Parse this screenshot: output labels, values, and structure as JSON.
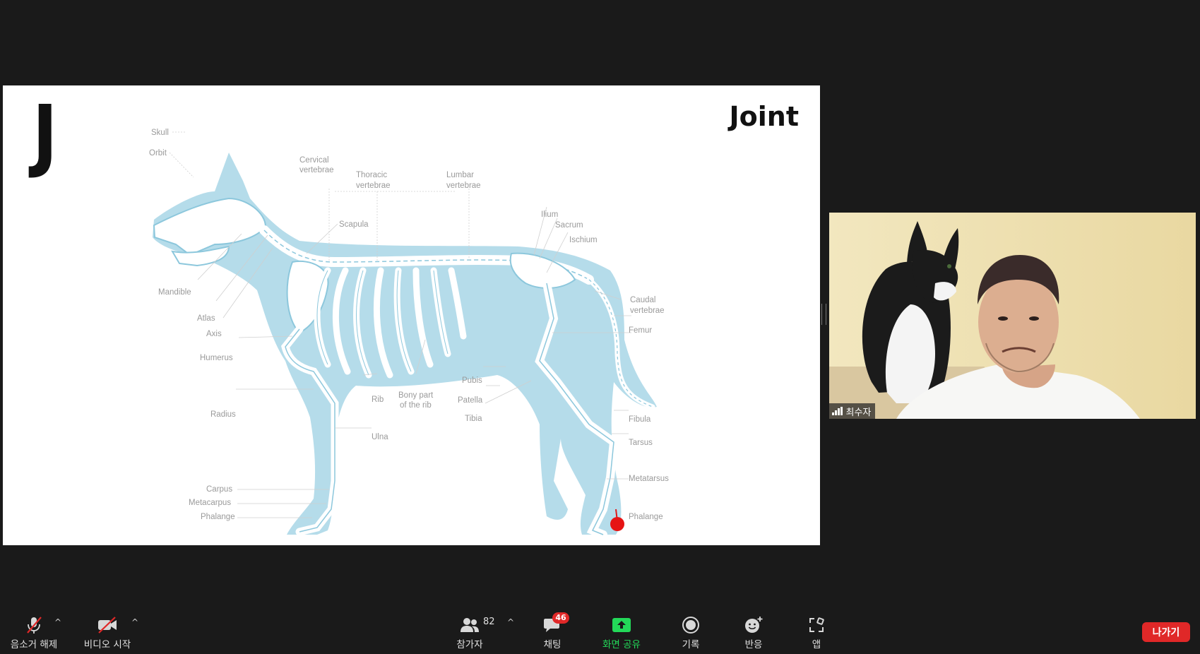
{
  "slide": {
    "letter": "J",
    "title": "Joint",
    "labels": {
      "skull": "Skull",
      "orbit": "Orbit",
      "cervical1": "Cervical",
      "cervical2": "vertebrae",
      "thoracic1": "Thoracic",
      "thoracic2": "vertebrae",
      "lumbar1": "Lumbar",
      "lumbar2": "vertebrae",
      "scapula": "Scapula",
      "ilium": "Ilium",
      "sacrum": "Sacrum",
      "ischium": "Ischium",
      "mandible": "Mandible",
      "atlas": "Atlas",
      "axis": "Axis",
      "humerus": "Humerus",
      "caudal1": "Caudal",
      "caudal2": "vertebrae",
      "femur": "Femur",
      "pubis": "Pubis",
      "bony1": "Bony part",
      "bony2": "of the rib",
      "rib": "Rib",
      "patella": "Patella",
      "tibia": "Tibia",
      "radius": "Radius",
      "fibula": "Fibula",
      "ulna": "Ulna",
      "tarsus": "Tarsus",
      "metatarsus": "Metatarsus",
      "carpus": "Carpus",
      "metacarpus": "Metacarpus",
      "phalange_front": "Phalange",
      "phalange_rear": "Phalange"
    }
  },
  "participant": {
    "name": "최수자"
  },
  "toolbar": {
    "mute_label": "음소거 해제",
    "video_label": "비디오 시작",
    "participants_label": "참가자",
    "participants_count": "82",
    "chat_label": "채팅",
    "chat_badge": "46",
    "share_label": "화면 공유",
    "record_label": "기록",
    "reactions_label": "반응",
    "apps_label": "앱",
    "leave_label": "나가기",
    "caret": "^"
  },
  "colors": {
    "share_green": "#23d959",
    "leave_red": "#e02828",
    "dog_silhouette": "#b5dcea",
    "bone": "#ffffff"
  }
}
